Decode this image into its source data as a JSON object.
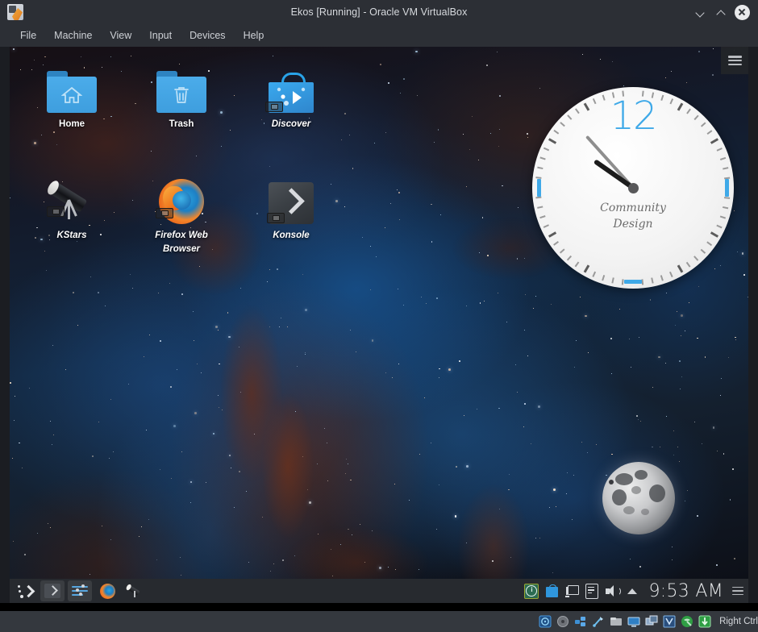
{
  "window": {
    "title": "Ekos [Running] - Oracle VM VirtualBox",
    "app_icon": "virtualbox-icon",
    "controls": {
      "minimize": "minimize-chevron-down",
      "maximize": "maximize-chevron-up",
      "close": "close-x"
    }
  },
  "menubar": {
    "items": [
      {
        "label": "File"
      },
      {
        "label": "Machine"
      },
      {
        "label": "View"
      },
      {
        "label": "Input"
      },
      {
        "label": "Devices"
      },
      {
        "label": "Help"
      }
    ]
  },
  "desktop": {
    "icons": [
      {
        "label": "Home",
        "icon": "home-folder-icon",
        "style": "plain"
      },
      {
        "label": "Trash",
        "icon": "trash-folder-icon",
        "style": "plain"
      },
      {
        "label": "Discover",
        "icon": "discover-bag-icon",
        "style": "italic"
      },
      {
        "label": "KStars",
        "icon": "telescope-icon",
        "style": "italic"
      },
      {
        "label": "Firefox Web Browser",
        "icon": "firefox-icon",
        "style": "italic"
      },
      {
        "label": "Konsole",
        "icon": "konsole-terminal-icon",
        "style": "italic"
      }
    ],
    "corner_panel_icon": "hamburger-menu-icon",
    "widgets": {
      "clock": {
        "numeral_top": "12",
        "caption_line1": "Community",
        "caption_line2": "Design",
        "hour_angle_deg": -55,
        "minute_angle_deg": -42,
        "accent_color": "#3fa9e8"
      },
      "moon": {
        "name": "moon-phase-widget",
        "phase": "full"
      }
    }
  },
  "taskbar": {
    "launchers": [
      {
        "name": "kde-application-launcher",
        "icon": "kde-menu-icon"
      },
      {
        "name": "konsole-task",
        "icon": "terminal-icon"
      },
      {
        "name": "system-settings-task",
        "icon": "sliders-icon"
      },
      {
        "name": "firefox-task",
        "icon": "firefox-icon"
      },
      {
        "name": "kstars-task",
        "icon": "telescope-icon"
      }
    ],
    "tray": [
      {
        "name": "system-info",
        "icon": "info-icon"
      },
      {
        "name": "discover-updates",
        "icon": "shopping-bag-icon"
      },
      {
        "name": "network-monitor",
        "icon": "network-icon"
      },
      {
        "name": "clipboard",
        "icon": "clipboard-icon"
      },
      {
        "name": "volume",
        "icon": "speaker-icon"
      },
      {
        "name": "show-hidden-icons",
        "icon": "chevron-up-icon"
      }
    ],
    "clock": "9:53 AM",
    "panel_menu_icon": "hamburger-menu-icon"
  },
  "statusbar": {
    "indicators": [
      {
        "name": "hard-disk-indicator",
        "icon": "hdd-icon",
        "color": "#2d79c6"
      },
      {
        "name": "optical-disk-indicator",
        "icon": "cd-icon",
        "color": "#8d9197"
      },
      {
        "name": "network-indicator",
        "icon": "network-icon",
        "color": "#3d8fd4"
      },
      {
        "name": "usb-indicator",
        "icon": "usb-icon",
        "color": "#4ba3e3"
      },
      {
        "name": "shared-folders-indicator",
        "icon": "folder-icon",
        "color": "#b9bcc1"
      },
      {
        "name": "display-indicator",
        "icon": "monitor-icon",
        "color": "#3d8fd4"
      },
      {
        "name": "recording-indicator",
        "icon": "screen-capture-icon",
        "color": "#7b94b5"
      },
      {
        "name": "vm-indicator",
        "icon": "virtualbox-cube-icon",
        "color": "#4b7fc0"
      },
      {
        "name": "mouse-integration-indicator",
        "icon": "globe-icon",
        "color": "#2f9e44"
      },
      {
        "name": "guest-additions-indicator",
        "icon": "download-arrow-icon",
        "color": "#2f9e44"
      }
    ],
    "host_key": "Right Ctrl"
  }
}
